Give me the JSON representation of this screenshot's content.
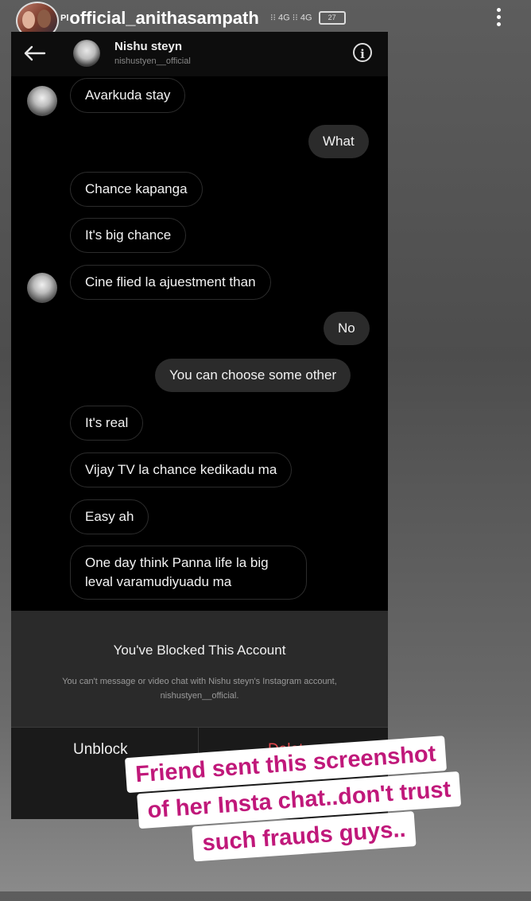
{
  "story": {
    "prefix": "Pl",
    "username": "official_anithasampath",
    "status_text": "⁝⁝ 4G ⁝⁝ 4G",
    "battery": "27"
  },
  "chat": {
    "name": "Nishu steyn",
    "handle": "nishustyen__official",
    "messages": [
      {
        "side": "in",
        "text": "Avarkuda stay",
        "avatar": true
      },
      {
        "side": "out",
        "text": "What"
      },
      {
        "side": "in",
        "text": "Chance kapanga"
      },
      {
        "side": "in",
        "text": "It's big chance"
      },
      {
        "side": "in",
        "text": "Cine flied la ajuestment than",
        "avatar": true
      },
      {
        "side": "out",
        "text": "No"
      },
      {
        "side": "out",
        "text": "You can choose some other"
      },
      {
        "side": "in",
        "text": "It's real"
      },
      {
        "side": "in",
        "text": "Vijay TV la chance kedikadu ma"
      },
      {
        "side": "in",
        "text": "Easy ah"
      },
      {
        "side": "in",
        "text": "One day think Panna life la big leval varamudiyuadu ma"
      }
    ]
  },
  "blocked": {
    "title": "You've Blocked This Account",
    "description": "You can't message or video chat with Nishu steyn's Instagram account, nishustyen__official.",
    "unblock_label": "Unblock",
    "delete_label": "Delete",
    "delete_color": "#e5484d"
  },
  "sticker": {
    "line1": "Friend sent this screenshot",
    "line2": "of her Insta chat..don't trust",
    "line3": "such frauds guys..",
    "text_color": "#c0187a"
  }
}
